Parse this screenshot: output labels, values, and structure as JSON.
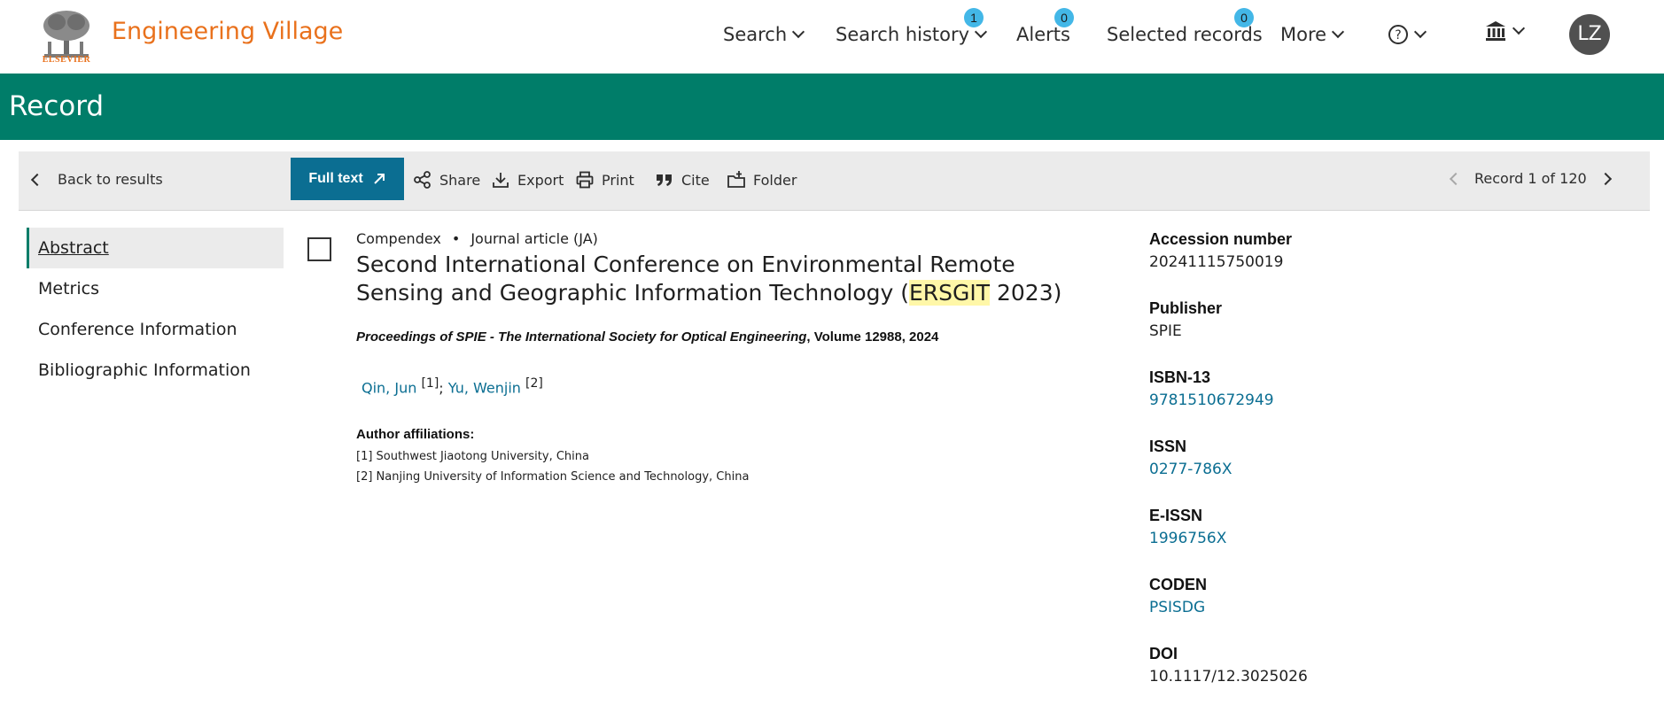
{
  "header": {
    "brand": "Engineering Village",
    "logo_word": "ELSEVIER",
    "nav": [
      {
        "label": "Search"
      },
      {
        "label": "Search history",
        "badge": "1"
      },
      {
        "label": "Alerts",
        "badge": "0"
      },
      {
        "label": "Selected records",
        "badge": "0"
      },
      {
        "label": "More"
      }
    ],
    "avatar": "LZ",
    "colors": {
      "brand": "#e9711c",
      "badge": "#43b7e7",
      "green": "#007d69",
      "link": "#0b6e92"
    }
  },
  "page": {
    "title": "Record"
  },
  "toolbar": {
    "back": "Back to results",
    "full_text": "Full text",
    "share": "Share",
    "export": "Export",
    "print": "Print",
    "cite": "Cite",
    "folder": "Folder",
    "pager": "Record 1 of 120"
  },
  "sidenav": {
    "items": [
      {
        "label": "Abstract"
      },
      {
        "label": "Metrics"
      },
      {
        "label": "Conference Information"
      },
      {
        "label": "Bibliographic Information"
      }
    ]
  },
  "record": {
    "database": "Compendex",
    "separator": "•",
    "doc_type": "Journal article (JA)",
    "title_before": "Second International Conference on Environmental Remote Sensing and Geographic Information Technology (",
    "title_highlight": "ERSGIT",
    "title_after": " 2023)",
    "source_italic": "Proceedings of SPIE - The International Society for Optical Engineering",
    "source_rest": ", Volume 12988, 2024",
    "authors": [
      {
        "name": "Qin, Jun",
        "sup": "[1]"
      },
      {
        "name": "Yu, Wenjin",
        "sup": "[2]"
      }
    ],
    "author_sep": ";",
    "affiliations_label": "Author affiliations:",
    "affiliations": [
      "[1] Southwest Jiaotong University, China",
      "[2] Nanjing University of Information Science and Technology, China"
    ]
  },
  "details": [
    {
      "label": "Accession number",
      "value": "20241115750019",
      "link": false
    },
    {
      "label": "Publisher",
      "value": "SPIE",
      "link": false
    },
    {
      "label": "ISBN-13",
      "value": "9781510672949",
      "link": true
    },
    {
      "label": "ISSN",
      "value": "0277-786X",
      "link": true
    },
    {
      "label": "E-ISSN",
      "value": "1996756X",
      "link": true
    },
    {
      "label": "CODEN",
      "value": "PSISDG",
      "link": true
    },
    {
      "label": "DOI",
      "value": "10.1117/12.3025026",
      "link": false
    }
  ]
}
